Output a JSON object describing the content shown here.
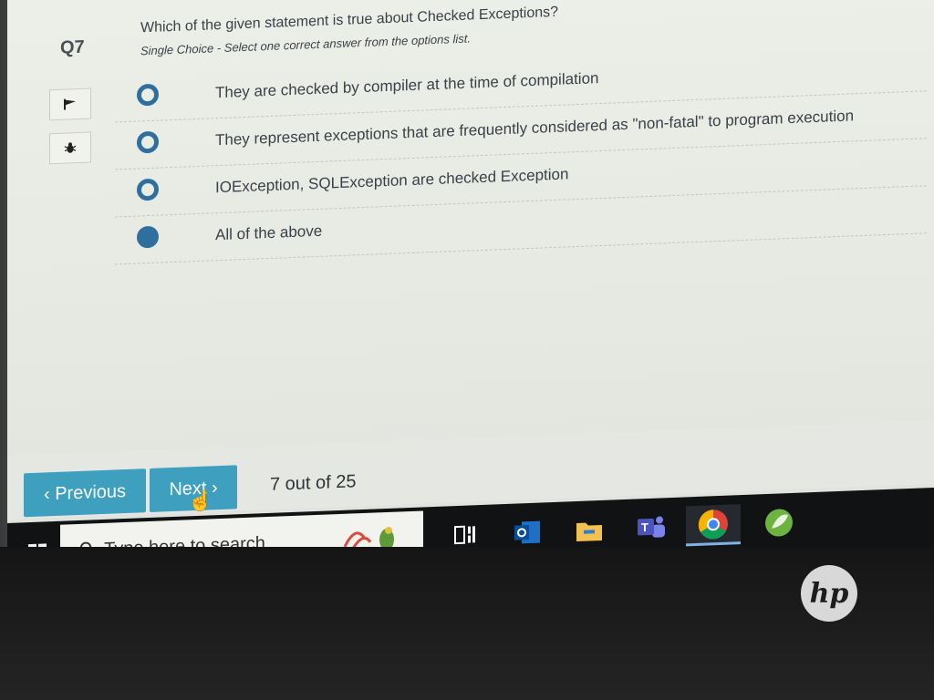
{
  "question": {
    "number": "Q7",
    "text": "Which of the given statement is true about Checked Exceptions?",
    "subtext": "Single Choice - Select one correct answer from the options list.",
    "options": [
      {
        "label": "They are checked by compiler at the time of compilation",
        "selected": false
      },
      {
        "label": "They represent exceptions that are frequently considered as \"non-fatal\" to program execution",
        "selected": false
      },
      {
        "label": "IOException, SQLException are checked Exception",
        "selected": false
      },
      {
        "label": "All of the above",
        "selected": true
      }
    ]
  },
  "side_icons": [
    "flag-icon",
    "bug-icon"
  ],
  "nav": {
    "previous_label": "‹ Previous",
    "next_label": "Next ›",
    "pager_text": "7 out of 25"
  },
  "taskbar": {
    "search_placeholder": "Type here to search",
    "apps": [
      "task-view-icon",
      "outlook-icon",
      "file-explorer-icon",
      "teams-icon",
      "chrome-icon",
      "spring-tool-icon"
    ]
  },
  "brand": {
    "logo_text": "hp"
  },
  "colors": {
    "accent": "#3f9fbf",
    "radio": "#2f6f9e",
    "taskbar": "#101214"
  }
}
